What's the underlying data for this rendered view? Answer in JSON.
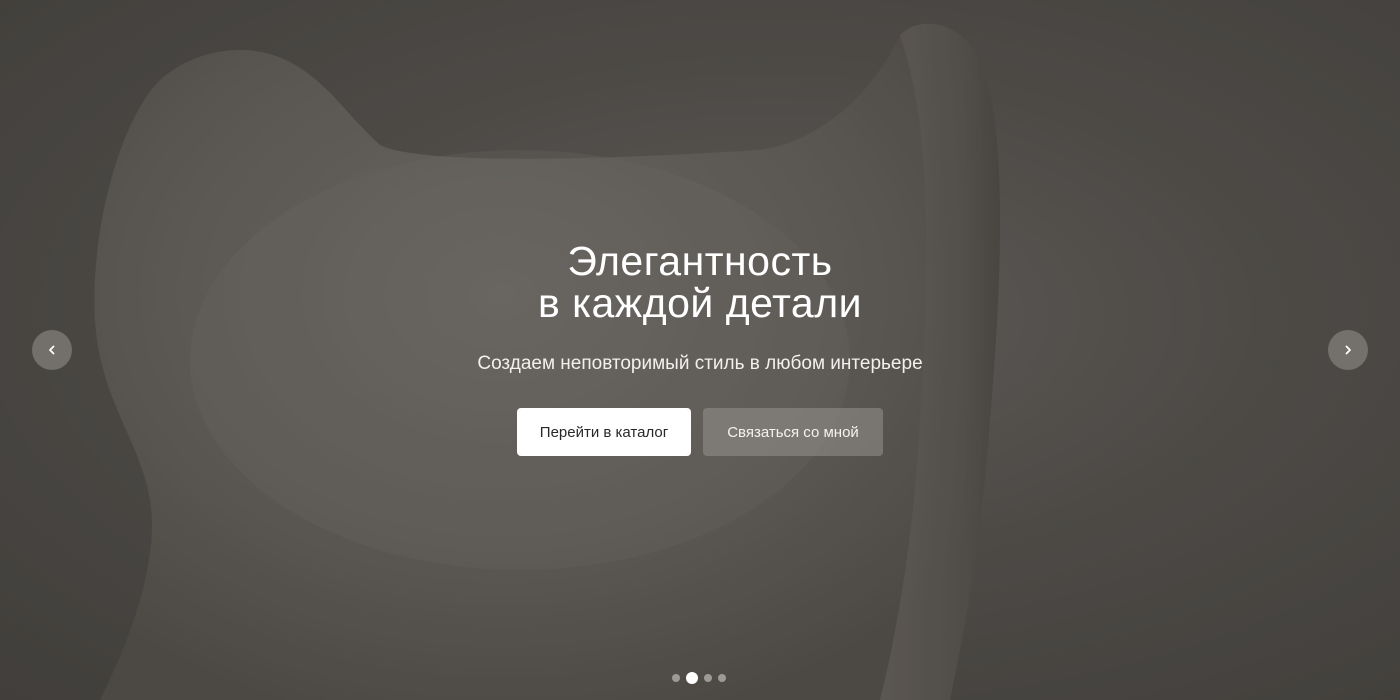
{
  "hero": {
    "title_line1": "Элегантность",
    "title_line2": "в каждой детали",
    "subtitle": "Создаем неповторимый стиль в любом интерьере",
    "primary_button": "Перейти в каталог",
    "secondary_button": "Связаться со мной"
  },
  "slider": {
    "prev_icon": "chevron-left-icon",
    "next_icon": "chevron-right-icon",
    "total_slides": 4,
    "active_slide": 2
  },
  "colors": {
    "background": "#56524f",
    "primary_button_bg": "#ffffff",
    "text": "#ffffff"
  }
}
